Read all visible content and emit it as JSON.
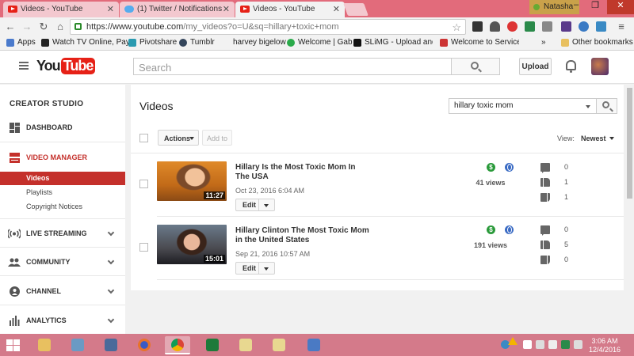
{
  "browser": {
    "tabs": [
      {
        "title": "Videos - YouTube",
        "favicon": "youtube-icon",
        "active": false
      },
      {
        "title": "(1) Twitter / Notifications",
        "favicon": "twitter-icon",
        "active": false
      },
      {
        "title": "Videos - YouTube",
        "favicon": "youtube-icon",
        "active": true
      }
    ],
    "profile_name": "Natasha",
    "url_host": "https://www.youtube.com",
    "url_path": "/my_videos?o=U&sq=hillary+toxic+mom",
    "bookmarks": [
      {
        "label": "Apps",
        "icon": "apps-icon"
      },
      {
        "label": "Watch TV Online, Pay",
        "icon": "x-icon"
      },
      {
        "label": "Pivotshare",
        "icon": "pivotshare-icon"
      },
      {
        "label": "Tumblr",
        "icon": "tumblr-icon"
      },
      {
        "label": "harvey bigelow",
        "icon": "page-icon"
      },
      {
        "label": "Welcome | Gab",
        "icon": "gab-icon"
      },
      {
        "label": "SLiMG - Upload and S",
        "icon": "slimg-icon"
      },
      {
        "label": "Welcome to Service C",
        "icon": "page-icon"
      },
      {
        "label": "Other bookmarks",
        "icon": "folder-icon"
      }
    ],
    "overflow": "»"
  },
  "youtube": {
    "logo_you": "You",
    "logo_tube": "Tube",
    "search_placeholder": "Search",
    "upload_label": "Upload"
  },
  "sidebar": {
    "title": "CREATOR STUDIO",
    "items": [
      {
        "label": "DASHBOARD",
        "icon": "dashboard-icon"
      },
      {
        "label": "VIDEO MANAGER",
        "icon": "video-manager-icon"
      },
      {
        "label": "LIVE STREAMING",
        "icon": "live-streaming-icon"
      },
      {
        "label": "COMMUNITY",
        "icon": "community-icon"
      },
      {
        "label": "CHANNEL",
        "icon": "channel-icon"
      },
      {
        "label": "ANALYTICS",
        "icon": "analytics-icon"
      }
    ],
    "subitems": [
      {
        "label": "Videos",
        "active": true
      },
      {
        "label": "Playlists",
        "active": false
      },
      {
        "label": "Copyright Notices",
        "active": false
      }
    ]
  },
  "main": {
    "heading": "Videos",
    "search_query": "hillary toxic mom",
    "actions_label": "Actions",
    "add_to_label": "Add to",
    "view_label": "View:",
    "sort_label": "Newest",
    "videos": [
      {
        "title": "Hillary Is the Most Toxic Mom In The USA",
        "date": "Oct 23, 2016 6:04 AM",
        "duration": "11:27",
        "views": "41 views",
        "comments": "0",
        "likes": "1",
        "dislikes": "1",
        "edit_label": "Edit"
      },
      {
        "title": "Hillary Clinton The Most Toxic Mom in the United States",
        "date": "Sep 21, 2016 10:57 AM",
        "duration": "15:01",
        "views": "191 views",
        "comments": "0",
        "likes": "5",
        "dislikes": "0",
        "edit_label": "Edit"
      }
    ]
  },
  "taskbar": {
    "time": "3:06 AM",
    "date": "12/4/2016"
  },
  "colors": {
    "youtube_red": "#e62117",
    "active_nav": "#c4302b",
    "taskbar": "#d47a8a",
    "tabbar": "#e26b7b"
  }
}
